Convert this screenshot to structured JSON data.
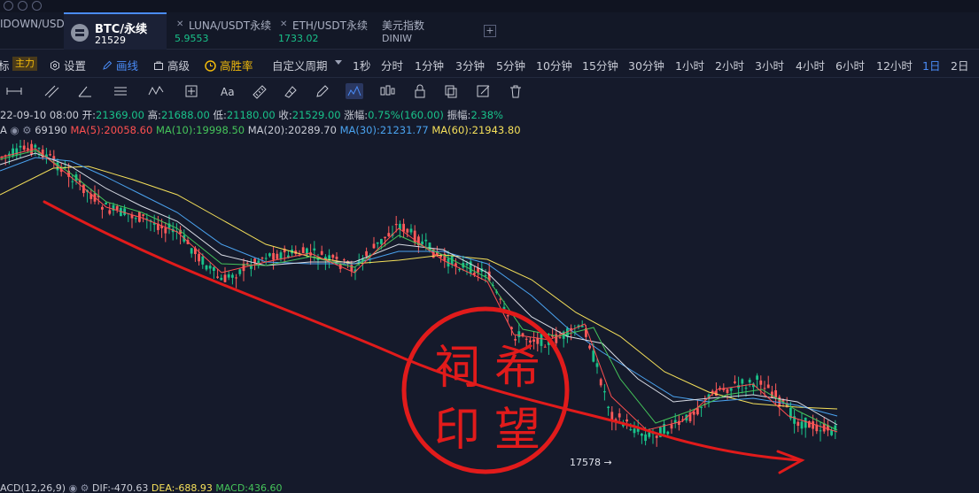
{
  "tabs": [
    {
      "name": "IDOWN/USD",
      "price": ""
    },
    {
      "name": "BTC/永续",
      "price": "21529"
    },
    {
      "name": "LUNA/USDT永续",
      "price": "5.9553"
    },
    {
      "name": "ETH/USDT永续",
      "price": "1733.02"
    },
    {
      "name": "美元指数",
      "price": "DINIW"
    }
  ],
  "colors": {
    "up": "#19c28a",
    "down": "#ff5a5a",
    "accent": "#4a8cf7",
    "background": "#151a2b"
  },
  "toolbar": {
    "indicator_prefix": "标",
    "main_badge": "主力",
    "settings": "设置",
    "draw": "画线",
    "advanced": "高级",
    "win_rate": "高胜率",
    "custom_period": "自定义周期",
    "intervals": [
      "1秒",
      "分时",
      "1分钟",
      "3分钟",
      "5分钟",
      "10分钟",
      "15分钟",
      "30分钟",
      "1小时",
      "2小时",
      "3小时",
      "4小时",
      "6小时",
      "12小时",
      "1日",
      "2日"
    ],
    "active_interval": "1日"
  },
  "drawing_tools": [
    "horizontal-line-icon",
    "parallel-lines-icon",
    "angle-icon",
    "horizontal-rays-icon",
    "wave-icon",
    "crosshair-icon",
    "text-icon",
    "ruler-icon",
    "magnet-icon",
    "pencil-icon",
    "brush-icon",
    "candle-bars-icon",
    "lock-icon",
    "copy-icon",
    "edit-icon",
    "trash-icon"
  ],
  "ohlc": {
    "date": "22-09-10 08:00",
    "open_label": "开:",
    "open": "21369.00",
    "high_label": "高:",
    "high": "21688.00",
    "low_label": "低:",
    "low": "21180.00",
    "close_label": "收:",
    "close": "21529.00",
    "change_label": "涨幅:",
    "change": "0.75%(160.00)",
    "amplitude_label": "振幅:",
    "amplitude": "2.38%"
  },
  "ma": {
    "prefix": "A",
    "value_hidden": "69190",
    "ma5": "MA(5):20058.60",
    "ma10": "MA(10):19998.50",
    "ma20": "MA(20):20289.70",
    "ma30": "MA(30):21231.77",
    "ma60": "MA(60):21943.80"
  },
  "chart_data": {
    "type": "candlestick",
    "symbol": "BTC/永续",
    "interval": "1日",
    "low_marker": "17578 →",
    "annotation_stamp": [
      "祠",
      "希",
      "印",
      "望"
    ]
  },
  "macd": {
    "label": "ACD(12,26,9)",
    "dif": "DIF:-470.63",
    "dea": "DEA:-688.93",
    "macd": "MACD:436.60"
  }
}
